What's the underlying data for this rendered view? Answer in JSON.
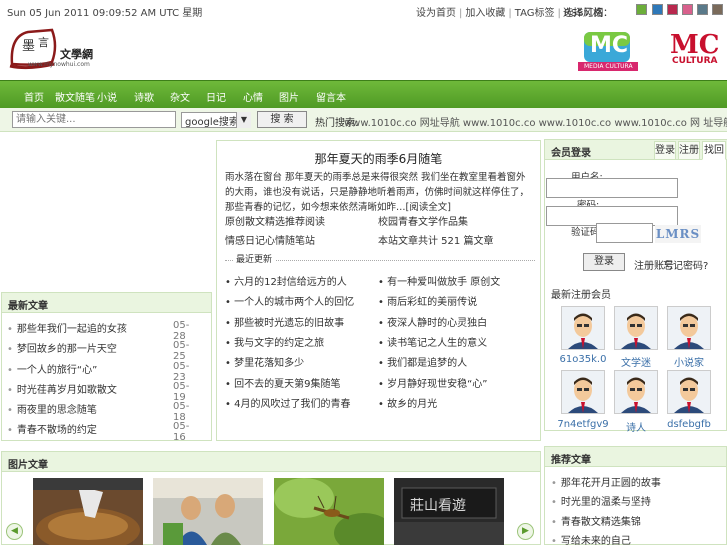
{
  "topbar": {
    "datetime": "Sun 05 Jun 2011 09:09:52 AM UTC",
    "datetime_suffix": "星期",
    "links": [
      "设为首页",
      "加入收藏",
      "TAG标签",
      "RSS订阅"
    ],
    "skin_label": "选择风格：",
    "swatches": [
      "#6cae3a",
      "#2e78b8",
      "#b8284e",
      "#d8608c",
      "#5a7a8a",
      "#7a6a5a"
    ]
  },
  "header": {
    "logo_text": "文學網",
    "logo_url": "www.mynowhui.com",
    "mc_text": "MC",
    "mc_caption": "MEDIA CULTURA",
    "mc2_text": "MC",
    "mc2_caption": "CULTURA"
  },
  "nav": {
    "items": [
      "首页",
      "散文随笔",
      "小说",
      "诗歌",
      "杂文",
      "日记",
      "心情",
      "图片",
      "留言本"
    ]
  },
  "search": {
    "placeholder": "请输入关键...",
    "engine": "google搜索",
    "button": "搜 索",
    "hotword_label": "热门搜索:",
    "hotwords": "www.1010c.co 网址导航 www.1010c.co www.1010c.co www.1010c.co 网 址导航"
  },
  "left_panel": {
    "title": "最新文章",
    "items": [
      {
        "title": "那些年我们一起追的女孩",
        "date": "05-28"
      },
      {
        "title": "梦回故乡的那一片天空",
        "date": "05-25"
      },
      {
        "title": "一个人的旅行“心”",
        "date": "05-23"
      },
      {
        "title": "时光荏苒岁月如歌散文",
        "date": "05-19"
      },
      {
        "title": "雨夜里的思念随笔",
        "date": "05-18"
      },
      {
        "title": "青春不散场的约定",
        "date": "05-16"
      }
    ]
  },
  "middle": {
    "title": "那年夏天的雨季6月随笔",
    "summary": "雨水落在窗台 那年夏天的雨季总是来得很突然 我们坐在教室里看着窗外的大雨，谁也没有说话，只是静静地听着雨声，仿佛时间就这样停住了，那些青春的记忆，如今想来依然清晰如昨…[阅读全文]",
    "links": [
      "原创散文精选推荐阅读",
      "校园青春文学作品集",
      "情感日记心情随笔站",
      "本站文章共计 521 篇文章"
    ],
    "recent_title": "最近更新",
    "recent": [
      "六月的12封信给远方的人",
      "一个人的城市两个人的回忆",
      "那些被时光遗忘的旧故事",
      "我与文字的约定之旅",
      "梦里花落知多少",
      "回不去的夏天第9集随笔",
      "4月的风吹过了我们的青春",
      "有一种爱叫做放手 原创文",
      "雨后彩虹的美丽传说",
      "夜深人静时的心灵独白",
      "读书笔记之人生的意义",
      "我们都是追梦的人",
      "岁月静好现世安稳“心”",
      "故乡的月光"
    ]
  },
  "login": {
    "title": "会员登录",
    "tabs": [
      "登录",
      "注册",
      "找回"
    ],
    "user_label": "用户名:",
    "pass_label": "密码:",
    "code_label": "验证码:",
    "captcha": "LMRS",
    "login_button": "登录",
    "register": "注册账号",
    "forgot": "忘记密码?",
    "members_title": "最新注册会员",
    "members": [
      "61o35k.0",
      "文学迷",
      "小说家",
      "7n4etfgv9",
      "诗人",
      "dsfebgfb"
    ]
  },
  "right2": {
    "title": "推荐文章",
    "items": [
      "那年花开月正圆的故事",
      "时光里的温柔与坚持",
      "青春散文精选集锦",
      "写给未来的自己"
    ]
  },
  "photos": {
    "title": "图片文章",
    "prev": "◀",
    "next": "▶"
  }
}
